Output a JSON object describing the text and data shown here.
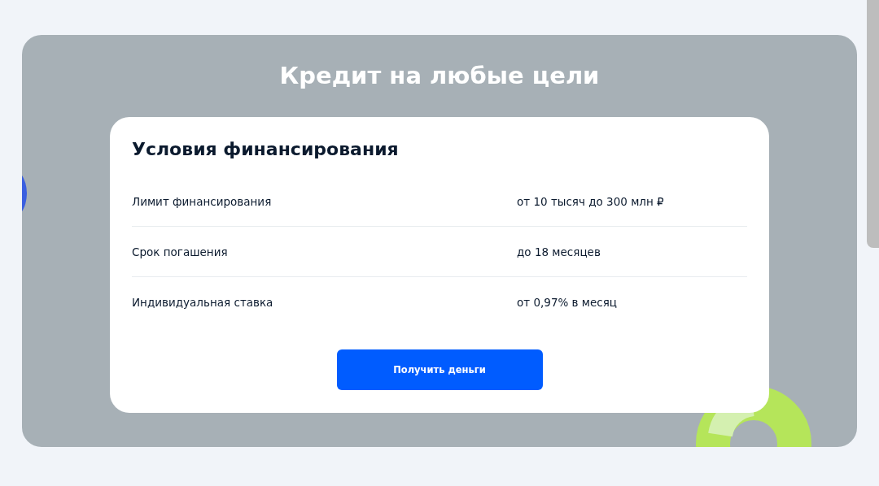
{
  "banner": {
    "title": "Кредит на любые цели"
  },
  "card": {
    "heading": "Условия финансирования",
    "rows": [
      {
        "label": "Лимит финансирования",
        "value": "от 10 тысяч до 300 млн ₽"
      },
      {
        "label": "Срок погашения",
        "value": "до 18 месяцев"
      },
      {
        "label": "Индивидуальная ставка",
        "value": "от 0,97% в месяц"
      }
    ],
    "button": "Получить деньги"
  }
}
